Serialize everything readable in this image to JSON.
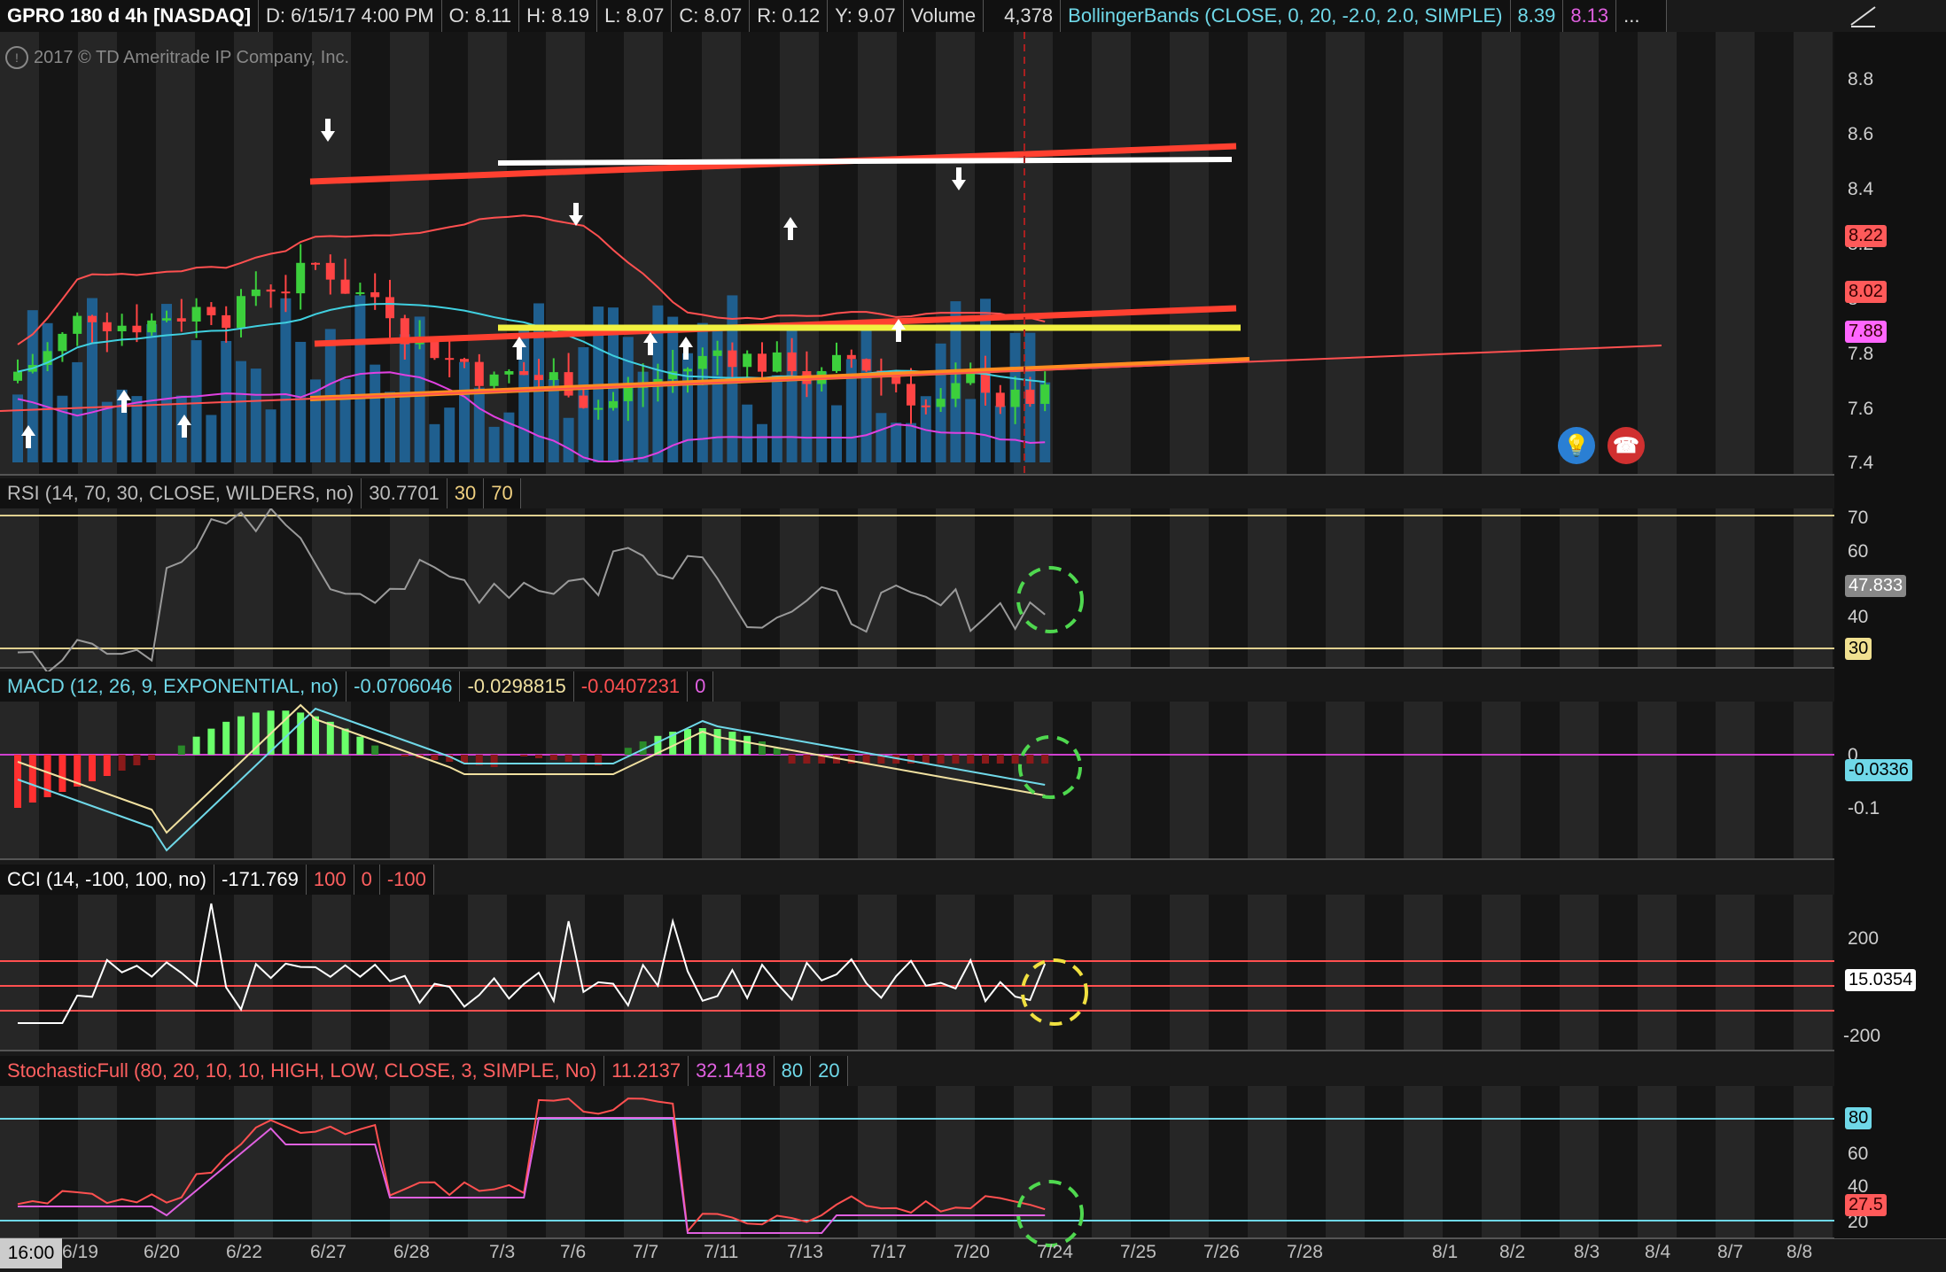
{
  "header": {
    "symbol": "GPRO 180 d 4h [NASDAQ]",
    "date": "D: 6/15/17 4:00 PM",
    "open": "O: 8.11",
    "high": "H: 8.19",
    "low": "L: 8.07",
    "close": "C: 8.07",
    "range": "R: 0.12",
    "y": "Y: 9.07",
    "volume_label": "Volume",
    "volume_value": "4,378",
    "bb_label": "BollingerBands (CLOSE, 0, 20, -2.0, 2.0, SIMPLE)",
    "bb_upper": "8.39",
    "bb_lower": "8.13",
    "more": "...",
    "draw_icon": "trend-line-icon"
  },
  "copyright": "2017 © TD Ameritrade IP Company, Inc.",
  "price_axis": {
    "ticks": [
      "8.8",
      "8.6",
      "8.4",
      "8.2",
      "8",
      "7.8",
      "7.6",
      "7.4"
    ],
    "tags": {
      "upper": "8.22",
      "mid": "8.02",
      "lower": "7.88"
    }
  },
  "rsi": {
    "label": "RSI (14, 70, 30, CLOSE, WILDERS, no)",
    "value": "30.7701",
    "oversold": "30",
    "overbought": "70",
    "ticks": [
      "70",
      "60",
      "40"
    ],
    "tag": "47.833",
    "tag_low": "30"
  },
  "macd": {
    "label": "MACD (12, 26, 9, EXPONENTIAL, no)",
    "value": "-0.0706046",
    "avg": "-0.0298815",
    "diff": "-0.0407231",
    "zero": "0",
    "ticks": [
      "0",
      "-0.1"
    ],
    "tag": "-0.0336"
  },
  "cci": {
    "label": "CCI (14, -100, 100, no)",
    "value": "-171.769",
    "over": "100",
    "zero": "0",
    "under": "-100",
    "ticks": [
      "200",
      "-200"
    ],
    "tag": "15.0354"
  },
  "stoch": {
    "label": "StochasticFull (80, 20, 10, 10, HIGH, LOW, CLOSE, 3, SIMPLE, No)",
    "k": "11.2137",
    "d": "32.1418",
    "ob": "80",
    "os": "20",
    "ticks": [
      "60",
      "40",
      "20"
    ],
    "tag_ob": "80",
    "tag_k": "27.5"
  },
  "x_axis": {
    "time_tag": "16:00",
    "labels": [
      "6/19",
      "6/20",
      "6/22",
      "6/27",
      "6/28",
      "7/3",
      "7/6",
      "7/7",
      "7/11",
      "7/13",
      "7/17",
      "7/20",
      "7/24",
      "7/25",
      "7/26",
      "7/28",
      "8/1",
      "8/2",
      "8/3",
      "8/4",
      "8/7",
      "8/8"
    ]
  },
  "colors": {
    "bg": "#1a1a1a",
    "bull": "#3ccf3c",
    "bear": "#ff4444",
    "bb_upper": "#ff5050",
    "bb_mid": "#40d0e0",
    "bb_lower": "#e040e0",
    "volume": "#1f5f8f",
    "support": "#f0f040",
    "resistance": "#ff4030"
  },
  "icons": {
    "idea": "lightbulb-icon",
    "phone": "phone-icon"
  }
}
